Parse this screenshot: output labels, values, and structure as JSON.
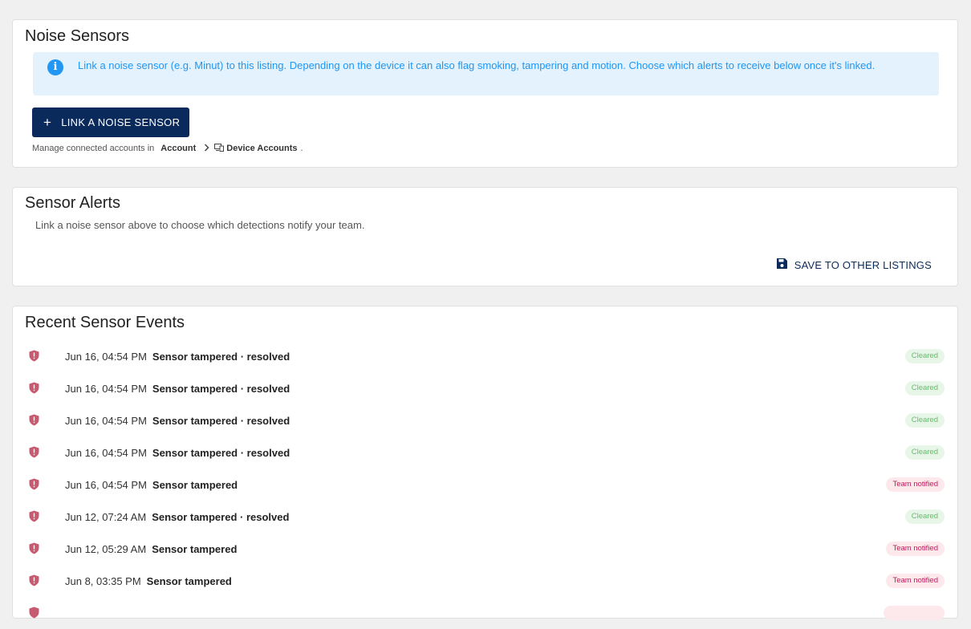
{
  "noise_sensors": {
    "title": "Noise Sensors",
    "info_text": "Link a noise sensor (e.g. Minut) to this listing. Depending on the device it can also flag smoking, tampering and motion. Choose which alerts to receive below once it's linked.",
    "link_button_label": "LINK A NOISE SENSOR",
    "manage_prefix": "Manage connected accounts in",
    "crumb_account": "Account",
    "crumb_device_accounts": "Device Accounts",
    "manage_suffix": "."
  },
  "sensor_alerts": {
    "title": "Sensor Alerts",
    "description": "Link a noise sensor above to choose which detections notify your team.",
    "save_button_label": "SAVE TO OTHER LISTINGS"
  },
  "recent_events": {
    "title": "Recent Sensor Events",
    "events": [
      {
        "time": "Jun 16, 04:54 PM",
        "text": "Sensor tampered · resolved",
        "status": "Cleared",
        "kind": "cleared"
      },
      {
        "time": "Jun 16, 04:54 PM",
        "text": "Sensor tampered · resolved",
        "status": "Cleared",
        "kind": "cleared"
      },
      {
        "time": "Jun 16, 04:54 PM",
        "text": "Sensor tampered · resolved",
        "status": "Cleared",
        "kind": "cleared"
      },
      {
        "time": "Jun 16, 04:54 PM",
        "text": "Sensor tampered · resolved",
        "status": "Cleared",
        "kind": "cleared"
      },
      {
        "time": "Jun 16, 04:54 PM",
        "text": "Sensor tampered",
        "status": "Team notified",
        "kind": "notified"
      },
      {
        "time": "Jun 12, 07:24 AM",
        "text": "Sensor tampered · resolved",
        "status": "Cleared",
        "kind": "cleared"
      },
      {
        "time": "Jun 12, 05:29 AM",
        "text": "Sensor tampered",
        "status": "Team notified",
        "kind": "notified"
      },
      {
        "time": "Jun 8, 03:35 PM",
        "text": "Sensor tampered",
        "status": "Team notified",
        "kind": "notified"
      },
      {
        "time": "",
        "text": "",
        "status": "",
        "kind": "notified"
      }
    ]
  },
  "colors": {
    "primary": "#0b2a5c",
    "info_bg": "#e3f2fd",
    "info_text": "#2196f3",
    "shield": "#c85a70",
    "cleared_bg": "#e8f5e9",
    "cleared_text": "#66bb6a",
    "notified_bg": "#fde8ec",
    "notified_text": "#c2185b"
  },
  "icons": {
    "info": "info-circle-icon",
    "plus": "plus-icon",
    "chevron": "chevron-right-icon",
    "device": "device-accounts-icon",
    "save": "floppy-disk-icon",
    "event": "shield-alert-icon"
  }
}
